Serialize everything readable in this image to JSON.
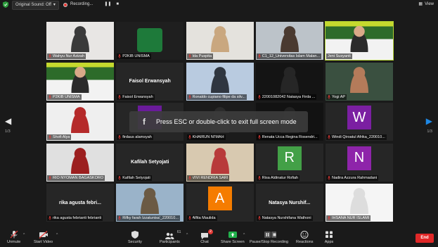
{
  "topbar": {
    "original_sound_label": "Original Sound: Off",
    "recording_label": "Recording...",
    "view_label": "View"
  },
  "pagination": {
    "left": "1/3",
    "right": "1/3"
  },
  "overlay": {
    "message": "Press ESC or double-click to exit full screen mode",
    "icon": "f"
  },
  "tiles": [
    {
      "name": "Wahyu Nur Azizah",
      "type": "video",
      "bg": "#e8e6e4",
      "accent": "#3a3a3a",
      "muted": true,
      "active": false
    },
    {
      "name": "P2KIB UNISMA",
      "type": "logo",
      "bg": "#1f1f1f",
      "accent": "#1e7a3a",
      "muted": true,
      "active": false
    },
    {
      "name": "Ida Puspita",
      "type": "video",
      "bg": "#e4e2dd",
      "accent": "#c9a77f",
      "muted": true,
      "active": false
    },
    {
      "name": "C1_12_Universitas Islam Malan...",
      "type": "video",
      "bg": "#bcc3c9",
      "accent": "#4a3a30",
      "muted": true,
      "active": false
    },
    {
      "name": "Jeni Susyanti",
      "type": "banner",
      "bg": "#2d6b2a",
      "accent": "#c5d92e",
      "muted": false,
      "active": true
    },
    {
      "name": "P2KIB UNISMA",
      "type": "banner",
      "bg": "#2d6b2a",
      "accent": "#c5d92e",
      "muted": true,
      "active": false
    },
    {
      "name": "Faisol Erwansyah",
      "type": "name",
      "display": "Faisol Erwansyah",
      "muted": true,
      "active": false
    },
    {
      "name": "Ronaldo cupiano filipe da silv...",
      "type": "video",
      "bg": "#b9cbe0",
      "accent": "#2f3640",
      "muted": true,
      "active": false
    },
    {
      "name": "22001082042 Natasya Firda ...",
      "type": "video",
      "bg": "#141414",
      "accent": "#262626",
      "muted": true,
      "active": false
    },
    {
      "name": "Yogi AP",
      "type": "video",
      "bg": "#3a5040",
      "accent": "#b47b5a",
      "muted": true,
      "active": false
    },
    {
      "name": "Shofi Alya",
      "type": "video",
      "bg": "#efefef",
      "accent": "#b52a2a",
      "muted": true,
      "active": false
    },
    {
      "name": "firdaus alamsyah",
      "type": "avatar",
      "letter": "",
      "bg": "#6a1b9a",
      "muted": true,
      "active": false
    },
    {
      "name": "KHAIRUN NI'MAH",
      "type": "video",
      "bg": "#1b1b1b",
      "accent": "#2a2a2a",
      "muted": true,
      "active": false
    },
    {
      "name": "Renata Ucca Regina Rosendri...",
      "type": "video",
      "bg": "#121212",
      "accent": "#222222",
      "muted": true,
      "active": false
    },
    {
      "name": "Windi Qiroatul Afrika_220010...",
      "type": "avatar",
      "letter": "W",
      "bg": "#7b1fa2",
      "muted": true,
      "active": false
    },
    {
      "name": "RIO NYOMAN BAGASKORO",
      "type": "video",
      "bg": "#e0e0e0",
      "accent": "#9c1f1f",
      "muted": true,
      "active": false
    },
    {
      "name": "Kafilah Setyojati",
      "type": "name",
      "display": "Kafilah Setyojati",
      "muted": true,
      "active": false
    },
    {
      "name": "VIVI RENDRIA SARI",
      "type": "video",
      "bg": "#d8c9b0",
      "accent": "#b83a3a",
      "muted": true,
      "active": false
    },
    {
      "name": "Risa Aldinatur Rofiah",
      "type": "avatar",
      "letter": "R",
      "bg": "#43a047",
      "muted": true,
      "active": false
    },
    {
      "name": "Nadira Azzura Rahmadani",
      "type": "avatar",
      "letter": "N",
      "bg": "#8e24aa",
      "muted": true,
      "active": false
    },
    {
      "name": "rika agusta febrianti febrianti",
      "type": "name",
      "display": "rika agusta febri...",
      "muted": true,
      "active": false
    },
    {
      "name": "Rifky farah Izzatunisa'_220010...",
      "type": "video",
      "bg": "#9ab3c9",
      "accent": "#6b5a44",
      "muted": true,
      "active": false
    },
    {
      "name": "Alfita Maulida",
      "type": "avatar",
      "letter": "A",
      "bg": "#f57c00",
      "muted": true,
      "active": false
    },
    {
      "name": "Natasya Nurshifana Wathoni",
      "type": "name",
      "display": "Natasya Nurshif...",
      "muted": true,
      "active": false
    },
    {
      "name": "IHSANA NUR ISLAMI",
      "type": "video",
      "bg": "#f5f5f5",
      "accent": "#dddddd",
      "muted": true,
      "active": false
    }
  ],
  "toolbar": {
    "unmute": "Unmute",
    "start_video": "Start Video",
    "security": "Security",
    "participants": "Participants",
    "participants_count": "61",
    "chat": "Chat",
    "chat_badge": "2",
    "share_screen": "Share Screen",
    "pause_recording": "Pause/Stop Recording",
    "reactions": "Reactions",
    "apps": "Apps",
    "end": "End"
  }
}
